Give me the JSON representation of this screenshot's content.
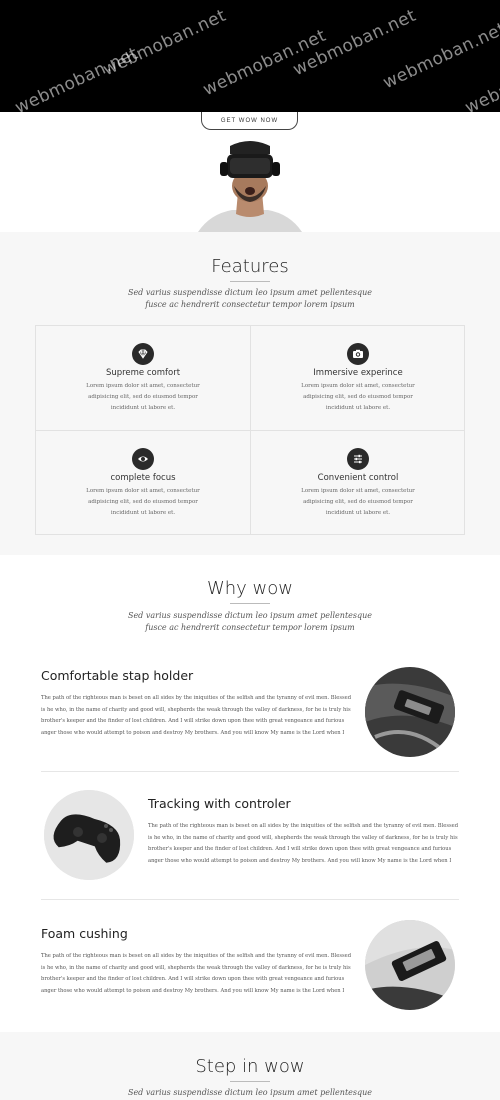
{
  "hero": {
    "watermarks": [
      "webmoban.net",
      "webmoban.net",
      "webmoban.net",
      "webmoban.net",
      "webmoban.net",
      "webmoban.net"
    ],
    "cta_label": "GET WOW NOW"
  },
  "features": {
    "title": "Features",
    "subtitle_line1": "Sed varius suspendisse dictum leo ipsum amet pellentesque",
    "subtitle_line2": "fusce ac hendrerit consectetur tempor lorem ipsum",
    "items": [
      {
        "icon": "diamond-icon",
        "title": "Supreme comfort",
        "desc": "Lorem ipsum dolor sit amet, consectetur adipisicing elit, sed do eiusmod tempor incididunt ut labore et."
      },
      {
        "icon": "camera-icon",
        "title": "Immersive experince",
        "desc": "Lorem ipsum dolor sit amet, consectetur adipisicing elit, sed do eiusmod tempor incididunt ut labore et."
      },
      {
        "icon": "eye-icon",
        "title": "complete focus",
        "desc": "Lorem ipsum dolor sit amet, consectetur adipisicing elit, sed do eiusmod tempor incididunt ut labore et."
      },
      {
        "icon": "sliders-icon",
        "title": "Convenient control",
        "desc": "Lorem ipsum dolor sit amet, consectetur adipisicing elit, sed do eiusmod tempor incididunt ut labore et."
      }
    ]
  },
  "why": {
    "title": "Why wow",
    "subtitle_line1": "Sed varius suspendisse dictum leo ipsum amet pellentesque",
    "subtitle_line2": "fusce ac hendrerit consectetur tempor lorem ipsum",
    "items": [
      {
        "title": "Comfortable stap holder",
        "text": "The path of the righteous man is beset on all sides by the iniquities of the selfish and the tyranny of evil men. Blessed is he who, in the name of charity and good will, shepherds the weak through the valley of darkness, for he is truly his brother's keeper and the finder of lost children. And I will strike down upon thee with great vengeance and furious anger those who would attempt to poison and destroy My brothers. And you will know My name is the Lord when I"
      },
      {
        "title": "Tracking with controler",
        "text": "The path of the righteous man is beset on all sides by the iniquities of the selfish and the tyranny of evil men. Blessed is he who, in the name of charity and good will, shepherds the weak through the valley of darkness, for he is truly his brother's keeper and the finder of lost children. And I will strike down upon thee with great vengeance and furious anger those who would attempt to poison and destroy My brothers. And you will know My name is the Lord when I"
      },
      {
        "title": "Foam cushing",
        "text": "The path of the righteous man is beset on all sides by the iniquities of the selfish and the tyranny of evil men. Blessed is he who, in the name of charity and good will, shepherds the weak through the valley of darkness, for he is truly his brother's keeper and the finder of lost children. And I will strike down upon thee with great vengeance and furious anger those who would attempt to poison and destroy My brothers. And you will know My name is the Lord when I"
      }
    ]
  },
  "steps": {
    "title": "Step in wow",
    "subtitle_line1": "Sed varius suspendisse dictum leo ipsum amet pellentesque"
  }
}
